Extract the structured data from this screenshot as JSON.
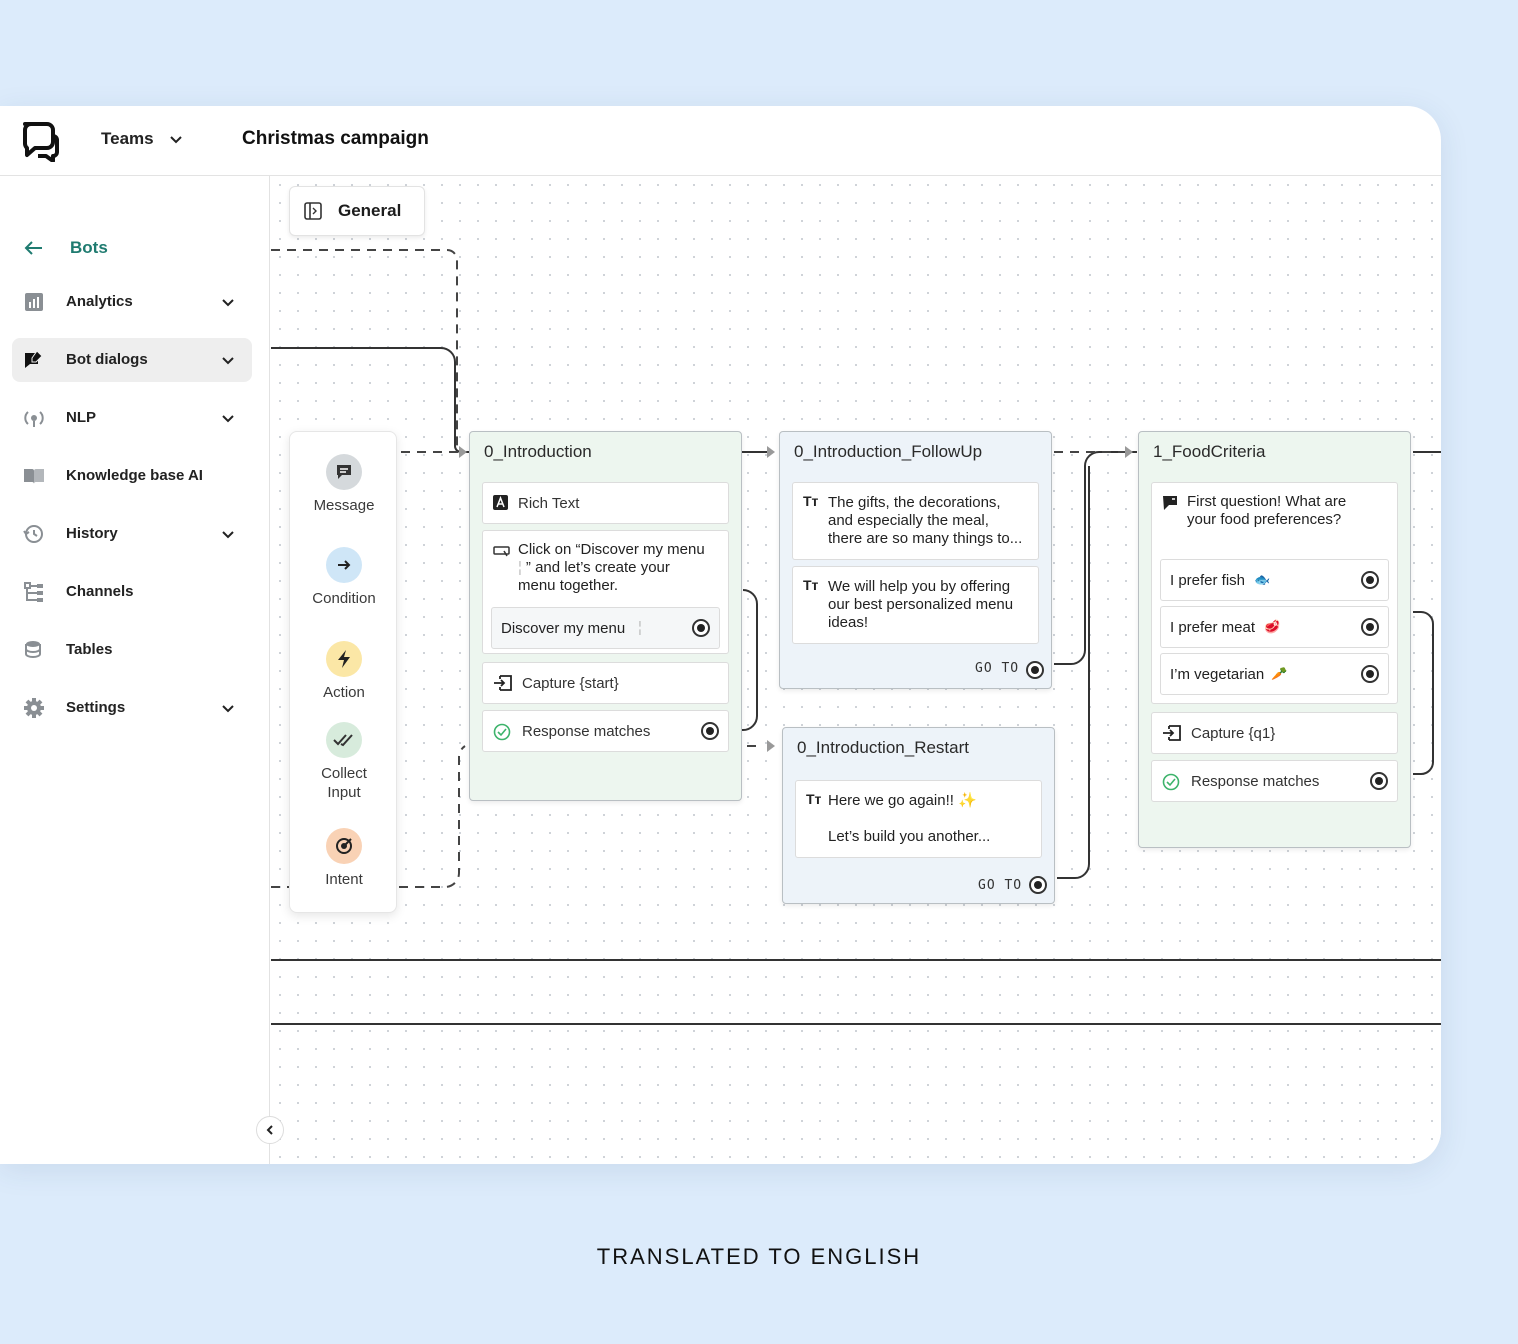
{
  "header": {
    "workspace_label": "Teams",
    "project_title": "Christmas campaign"
  },
  "sidebar": {
    "back_label": "Bots",
    "items": [
      {
        "label": "Analytics",
        "icon": "bar-chart-icon",
        "expandable": true
      },
      {
        "label": "Bot dialogs",
        "icon": "chat-edit-icon",
        "expandable": true,
        "active": true
      },
      {
        "label": "NLP",
        "icon": "nlp-icon",
        "expandable": true
      },
      {
        "label": "Knowledge base AI",
        "icon": "book-icon",
        "expandable": false
      },
      {
        "label": "History",
        "icon": "history-icon",
        "expandable": true
      },
      {
        "label": "Channels",
        "icon": "channels-icon",
        "expandable": false
      },
      {
        "label": "Tables",
        "icon": "database-icon",
        "expandable": false
      },
      {
        "label": "Settings",
        "icon": "gear-icon",
        "expandable": true
      }
    ]
  },
  "canvas": {
    "tab_label": "General",
    "palette": [
      {
        "label": "Message",
        "icon": "message-icon",
        "color": "#d5d9dc"
      },
      {
        "label": "Condition",
        "icon": "arrow-right-icon",
        "color": "#cfe6f7"
      },
      {
        "label": "Action",
        "icon": "bolt-icon",
        "color": "#fbe7a6"
      },
      {
        "label": "Collect",
        "label2": "Input",
        "icon": "double-check-icon",
        "color": "#d7ebdc"
      },
      {
        "label": "Intent",
        "icon": "target-icon",
        "color": "#f9d2b5"
      }
    ],
    "nodes": {
      "intro": {
        "title": "0_Introduction",
        "rich_text": "Rich Text",
        "text1": "Click on “Discover my menu",
        "text2": "” and let’s create your",
        "text3": "menu together.",
        "button": "Discover my menu",
        "capture": "Capture {start}",
        "response": "Response matches"
      },
      "followup": {
        "title": "0_Introduction_FollowUp",
        "msg1_l1": "The gifts, the decorations,",
        "msg1_l2": "and especially the meal,",
        "msg1_l3": "there are so many things to...",
        "msg2_l1": "We will help you by offering",
        "msg2_l2": "our best personalized menu",
        "msg2_l3": "ideas!",
        "goto": "GO TO"
      },
      "restart": {
        "title": "0_Introduction_Restart",
        "msg_l1": "Here we go again!!",
        "msg_l2": "Let’s build you another...",
        "goto": "GO TO"
      },
      "food": {
        "title": "1_FoodCriteria",
        "question_l1": "First question! What are",
        "question_l2": "your food preferences?",
        "option1": "I prefer fish",
        "option2": "I prefer meat",
        "option3": "I’m vegetarian",
        "capture": "Capture {q1}",
        "response": "Response matches"
      }
    }
  },
  "footer": {
    "caption": "TRANSLATED TO ENGLISH"
  },
  "colors": {
    "accent": "#1f7b70",
    "background": "#dcebfb",
    "node_green": "#edf6ef",
    "node_blue": "#edf3f9"
  }
}
